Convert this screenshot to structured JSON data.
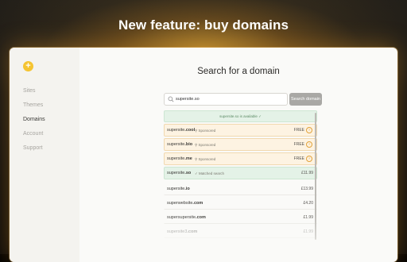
{
  "headline": "New feature: buy domains",
  "sidebar": {
    "logo_glyph": "+",
    "items": [
      {
        "label": "Sites"
      },
      {
        "label": "Themes"
      },
      {
        "label": "Domains"
      },
      {
        "label": "Account"
      },
      {
        "label": "Support"
      }
    ],
    "active": "Domains"
  },
  "main": {
    "title": "Search for a domain",
    "search": {
      "value": "supersite.so",
      "icon": "search-icon"
    },
    "search_button": "Search domain",
    "availability": "supersite.so is available  ✓",
    "results": [
      {
        "name": "supersite",
        "tld": ".cool",
        "tag": "Sponsored",
        "price": "FREE",
        "style": "sponsored"
      },
      {
        "name": "supersite",
        "tld": ".bio",
        "tag": "Sponsored",
        "price": "FREE",
        "style": "sponsored"
      },
      {
        "name": "supersite",
        "tld": ".me",
        "tag": "Sponsored",
        "price": "FREE",
        "style": "sponsored"
      },
      {
        "name": "supersite",
        "tld": ".so",
        "tag": "Matched search",
        "price": "£11.99",
        "style": "matched"
      },
      {
        "name": "supersite",
        "tld": ".io",
        "tag": "",
        "price": "£13.99",
        "style": "plain"
      },
      {
        "name": "superwebsite",
        "tld": ".com",
        "tag": "",
        "price": "£4.20",
        "style": "plain"
      },
      {
        "name": "supersupersite",
        "tld": ".com",
        "tag": "",
        "price": "£1.99",
        "style": "plain"
      },
      {
        "name": "supersite3",
        "tld": ".com",
        "tag": "",
        "price": "£1.99",
        "style": "plain"
      }
    ]
  },
  "colors": {
    "accent": "#f5c431",
    "sponsored_bg": "#fdf3e2",
    "matched_bg": "#e4f2e7"
  }
}
